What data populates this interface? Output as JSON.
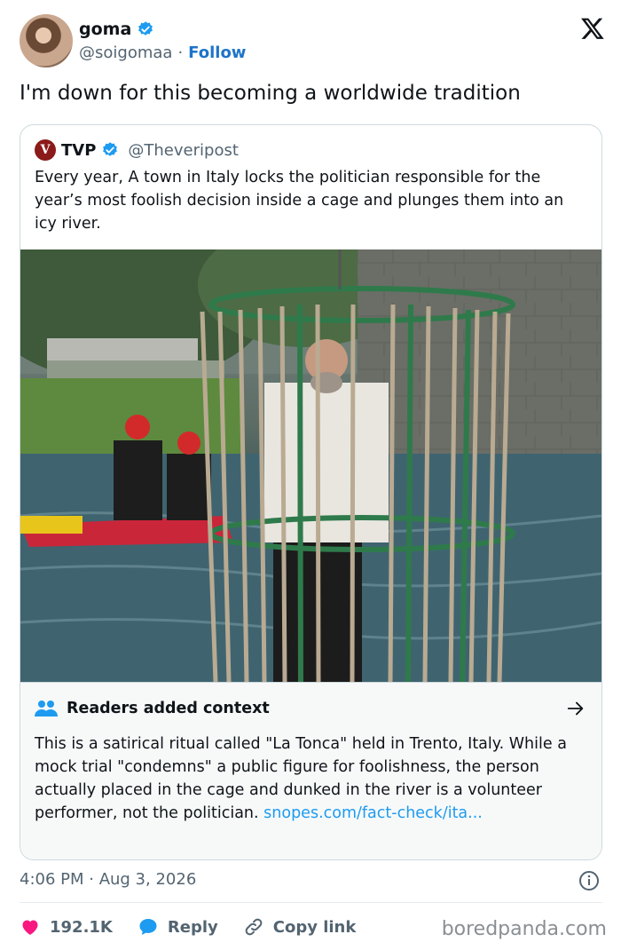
{
  "author": {
    "name": "goma",
    "handle": "@soigomaa",
    "separator": "·",
    "follow_label": "Follow"
  },
  "tweet": {
    "text": "I'm down for this becoming a worldwide tradition"
  },
  "quoted": {
    "logo_letter": "V",
    "name": "TVP",
    "handle": "@Theveripost",
    "text": "Every year, A town in Italy locks the politician responsible for the year’s most foolish decision inside a cage and plunges them into an icy river."
  },
  "context_note": {
    "title": "Readers added context",
    "text": "This is a satirical ritual called \"La Tonca\" held in Trento, Italy. While a mock trial \"condemns\" a public figure for foolishness, the person actually placed in the cage and dunked in the river is a volunteer performer, not the politician. ",
    "link": "snopes.com/fact-check/ita..."
  },
  "meta": {
    "timestamp": "4:06 PM · Aug 3, 2026"
  },
  "actions": {
    "likes": "192.1K",
    "reply_label": "Reply",
    "copy_label": "Copy link"
  },
  "watermark": "boredpanda.com",
  "colors": {
    "verified": "#1d9bf0",
    "like": "#f91880",
    "reply": "#1d9bf0",
    "link": "#1d9bf0",
    "follow": "#1d74c9"
  },
  "icons": [
    "verified-badge-icon",
    "x-logo-icon",
    "people-icon",
    "arrow-right-icon",
    "info-icon",
    "heart-icon",
    "reply-bubble-icon",
    "link-icon"
  ]
}
